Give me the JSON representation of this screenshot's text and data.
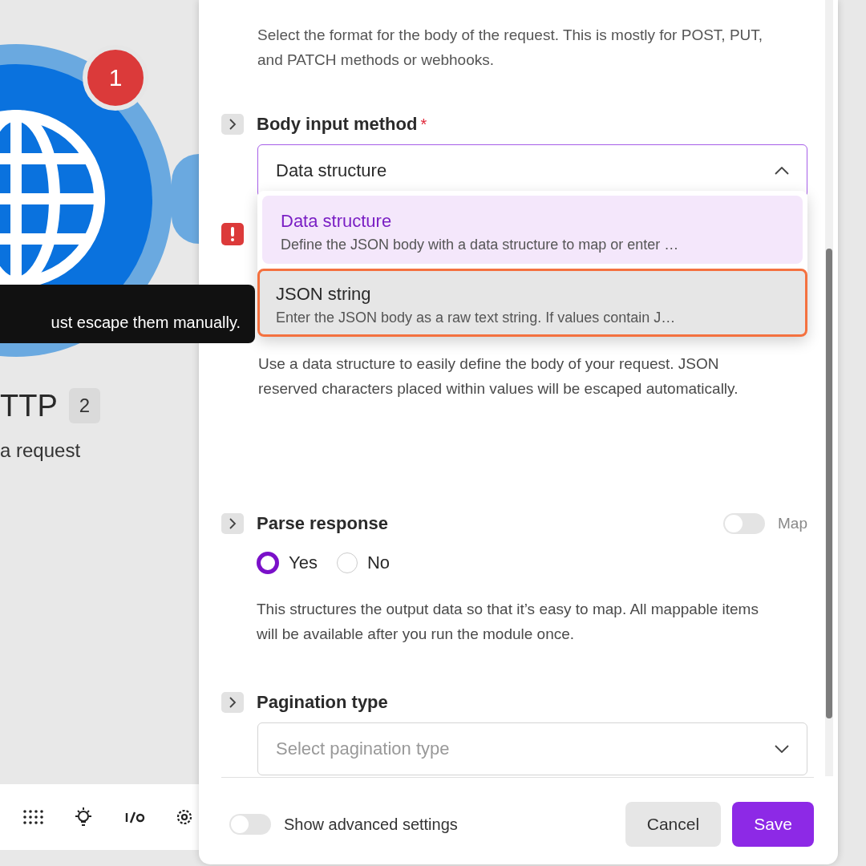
{
  "canvas": {
    "module": {
      "title": "TTP",
      "count": "2",
      "subtitle": "a request",
      "badge": "1"
    },
    "tooltip": "ust escape them manually.",
    "toolbar": [
      {
        "kind": "grid"
      },
      {
        "kind": "bulb"
      },
      {
        "kind": "io"
      },
      {
        "kind": "gear"
      }
    ]
  },
  "panel": {
    "intro": "Select the format for the body of the request. This is mostly for POST, PUT, and PATCH methods or webhooks.",
    "body_input": {
      "label": "Body input method",
      "required_mark": "*",
      "value": "Data structure",
      "expanded": true,
      "options": [
        {
          "title": "Data structure",
          "description": "Define the JSON body with a data structure to map or enter …",
          "selected": true,
          "highlighted": false
        },
        {
          "title": "JSON string",
          "description": "Enter the JSON body as a raw text string. If values contain J…",
          "selected": false,
          "highlighted": true
        }
      ],
      "error": true,
      "help": "Use a data structure to easily define the body of your request. JSON reserved characters placed within values will be escaped automatically."
    },
    "parse_response": {
      "label": "Parse response",
      "map_label": "Map",
      "map_on": false,
      "options": [
        {
          "label": "Yes",
          "selected": true
        },
        {
          "label": "No",
          "selected": false
        }
      ],
      "help": "This structures the output data so that it’s easy to map. All mappable items will be available after you run the module once."
    },
    "pagination": {
      "label": "Pagination type",
      "placeholder": "Select pagination type",
      "expanded": false
    },
    "footer": {
      "advanced_label": "Show advanced settings",
      "advanced_on": false,
      "buttons": [
        {
          "label": "Cancel",
          "kind": "secondary"
        },
        {
          "label": "Save",
          "kind": "primary"
        }
      ]
    }
  }
}
